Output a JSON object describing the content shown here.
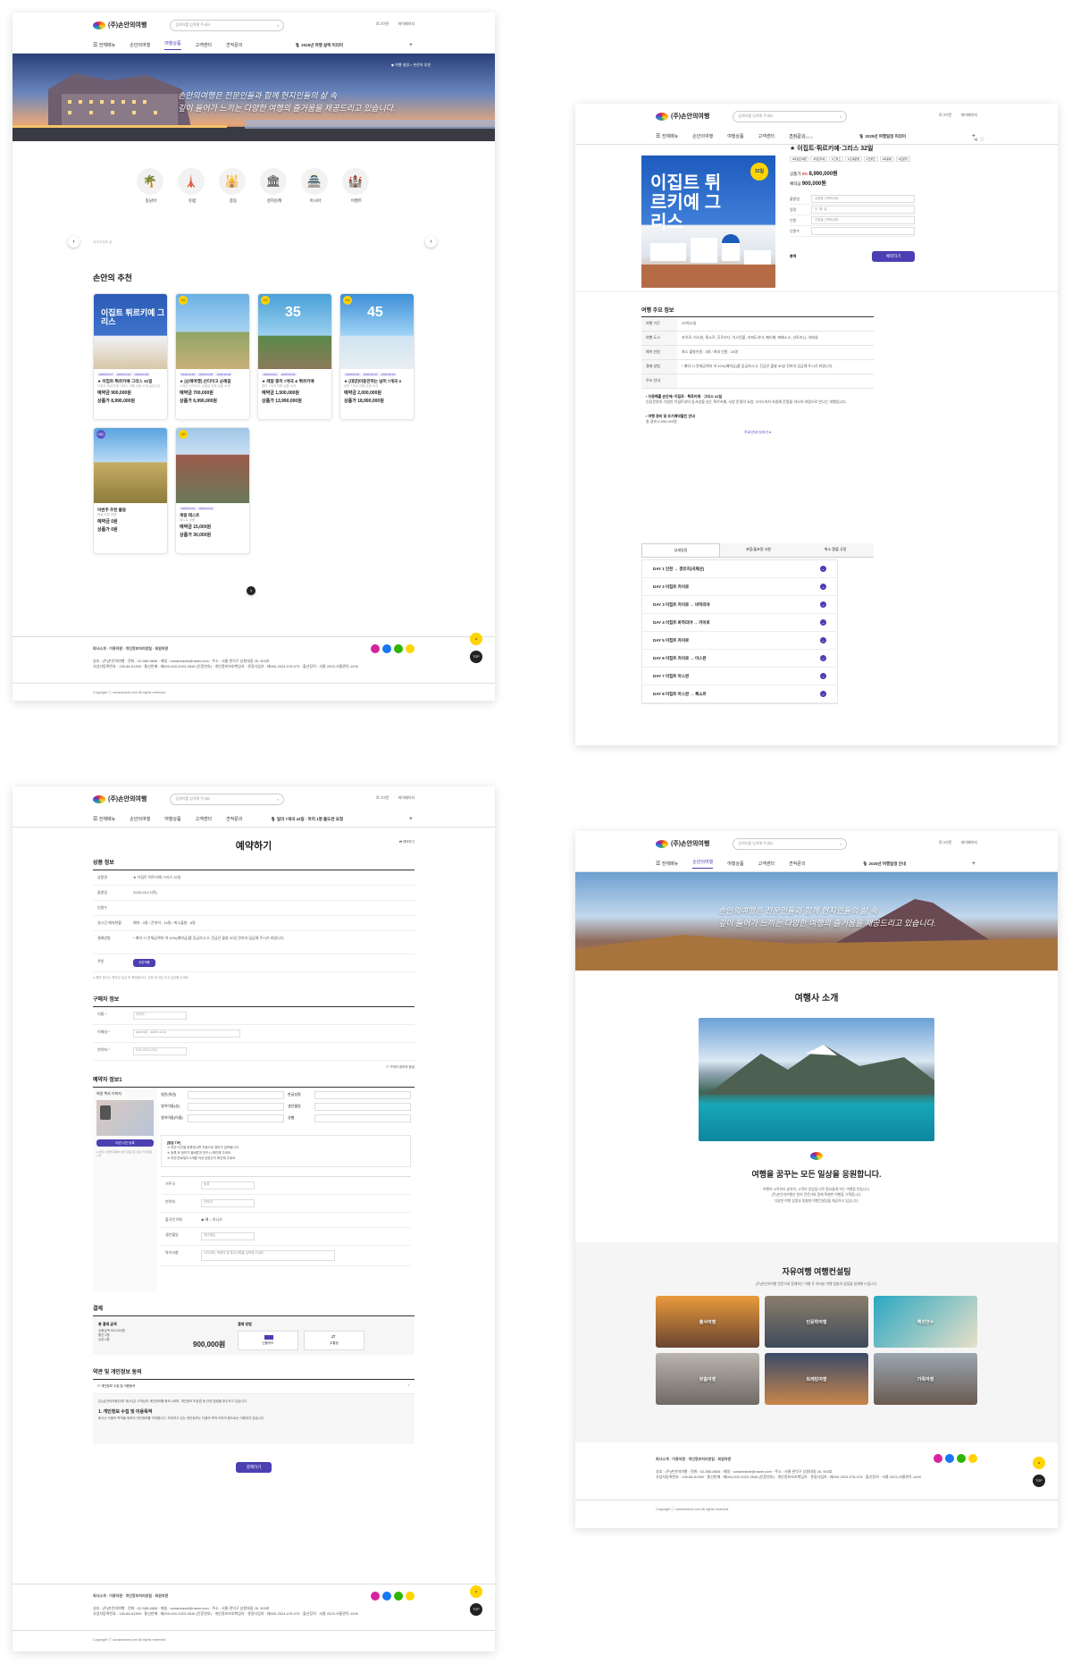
{
  "common": {
    "logo": "(주)손안의여행",
    "search_placeholder": "검색어를 입력해 주세요",
    "util_login": "로그아웃",
    "util_mypage": "마이페이지",
    "nav": [
      "전체메뉴",
      "손안의여행",
      "여행상품",
      "고객센터",
      "견적문의"
    ],
    "ticker_p1": "2025년 여행 살짝 미리미",
    "ticker_p2": "2025년 여행일정 미리미",
    "ticker_p3": "일의 7개국 43일 · 마치 1명 출도연 요청",
    "ticker_p4": "2025년 여행일정 안내",
    "footer_links": "회사소개 · 이용약관 · 개인정보처리방침 · 회원약관",
    "footer_info1": "상호 : (주)손안의여행 · 전화 : 02-585-8608 · 메일 : sonantravel@naver.com · 주소 : 서울 관악구 상원대길 26, 903호",
    "footer_info2": "사업자등록번호 : 135-86-51359 · 통신판매 : 제000-000-2023-3545 (인증번호) · 개인정보보호책임자 · 관광사업자 : 제000-2024-078-075 · 출산장려 · 서울 2023-서울관악-1490",
    "copyright": "Copyright ⓒ sonantravel.com All rights reserved."
  },
  "p1": {
    "hero_text": [
      "손안의여행은 전문인들과 함께 현지인들의 삶 속",
      "깊이 들어가 느끼는 다양한 여행의 즐거움을 제공드리고 있습니다."
    ],
    "hero_tag": "◆ 여행 설명 > 손안의 추천",
    "categories": [
      {
        "icon": "🌴",
        "label": "동남아"
      },
      {
        "icon": "🗼",
        "label": "유럽"
      },
      {
        "icon": "🕌",
        "label": "중동"
      },
      {
        "icon": "🏛",
        "label": "성지순례"
      },
      {
        "icon": "🏯",
        "label": "아시아"
      },
      {
        "icon": "🏰",
        "label": "이벤트"
      }
    ],
    "slider_caption": "여기에 정보 글",
    "section_title": "손안의 추천",
    "cards": [
      {
        "tags": [
          "2025.03.27",
          "2025.04.01",
          "2025.04.18"
        ],
        "name": "★ 이집트·튀르키예·그리스 32일",
        "desc": "이집트·튀르키예·그리스 여행 상품 소개 글입니다",
        "price1": "예약금 900,000원",
        "price2": "상품가 8,990,000원"
      },
      {
        "tags": [
          "2025.03.20",
          "2025.04.05",
          "2025.05.08"
        ],
        "name": "★ [순례여행] 산티아고 순례길",
        "desc": "스페인 산티아고 순례길 여행 상품 소개",
        "price1": "예약금 700,000원",
        "price2": "상품가 6,990,000원"
      },
      {
        "tags": [
          "2025.04.01",
          "2025.05.03"
        ],
        "name": "★ 레알 중미 7개국 & 튀르키예",
        "desc": "중미 7개국 여행 상품 소개",
        "price1": "예약금 1,500,000원",
        "price2": "상품가 13,990,000원"
      },
      {
        "tags": [
          "2025.04.03",
          "2025.05.01",
          "2025.06.01"
        ],
        "name": "★ [대양]이동전하는 남미 7개국 4",
        "desc": "남미 7개국 여행 상품 소개",
        "price1": "예약금 2,000,000원",
        "price2": "상품가 18,990,000원"
      },
      {
        "tags": [],
        "name": "이번주 추천 출동",
        "desc": "몽골 초원 여행",
        "price1": "예약금 0원",
        "price2": "상품가 0원"
      },
      {
        "tags": [
          "2025.03.01",
          "2025.06.01"
        ],
        "name": "게링 테스트",
        "desc": "테스트 상품",
        "price1": "예약금 15,000원",
        "price2": "상품가 30,000원"
      }
    ]
  },
  "p2": {
    "poster_title": "이집트 튀르키예 그리스",
    "poster_days": "32일",
    "code": "상품코드 A00014",
    "title": "★ 이집트·튀르키예·그리스 32일",
    "chips": [
      "#이집트여행",
      "#튀르키예",
      "#그리스",
      "#고대문명",
      "#크루즈",
      "#지중해",
      "#인문학"
    ],
    "price_label": "상품가",
    "discount": "0%",
    "price": "8,990,000원",
    "deposit_label": "예약금",
    "deposit": "900,000원",
    "fields": [
      {
        "k": "출발일",
        "v": "상품을 선택하세요"
      },
      {
        "k": "일정",
        "v": "년. 월. 일"
      },
      {
        "k": "인원",
        "v": "인원을 선택하세요"
      },
      {
        "k": "인원수",
        "v": ""
      }
    ],
    "total_label": "총액",
    "book_btn": "예약하기",
    "info_title": "여행 주요 정보",
    "table": [
      {
        "k": "여행 기간",
        "v": "29박32일"
      },
      {
        "k": "여행 도시",
        "v": "카이로, 아스완, 룩소르, 후르가다, 이스탄불, 카파도키아, 페티예, 에페소스, 산토리니, 아테네"
      },
      {
        "k": "예약 인원",
        "v": "최소 출발인원 : 8명 / 최대 인원 : 16명"
      },
      {
        "k": "결제 방법",
        "v": "* 예약 시 전체금액의 약 10%(예약금)를 입금하시고, 잔금은 출발 30일 전까지 입금해 주시기 바랍니다."
      },
      {
        "k": "주요 안내",
        "v": ""
      }
    ],
    "notes_title": "▪ 지중해를 손안에! 이집트 · 튀르키예 · 그리스 32일",
    "notes": "인류문명의 기원인 이집트부터 동서양을 잇는 튀르키예, 서양 문명의 요람 그리스까지 지중해 문명을 하나의 여정으로 만나는 여행입니다.",
    "notes_title2": "▪ 여행 경비 및 조기예약할인 안내",
    "notes2": "총 경비 8,990,000원",
    "more": "주요안내 더보기 ▾",
    "tabs": [
      "상세일정",
      "포함/불포함 사항",
      "취소·환불 규정"
    ],
    "days": [
      "DAY 1  인천 → 경유지(국제선)",
      "DAY 2  이집트 카이로",
      "DAY 3  이집트 카이로 → 바하리야",
      "DAY 4  이집트 바하리야 → 카이로",
      "DAY 5  이집트 카이로",
      "DAY 6  이집트 카이로 → 아스완",
      "DAY 7  이집트 아스완",
      "DAY 8  이집트 아스완 → 룩소르"
    ]
  },
  "p3": {
    "page_title": "예약하기",
    "print": "🖶 예약하기",
    "sec1": "상품 정보",
    "prod": [
      {
        "k": "상품명",
        "v": "★ 이집트·튀르키예·그리스 32일"
      },
      {
        "k": "출발일",
        "v": "2025-03-27(목)"
      },
      {
        "k": "인원수",
        "v": ""
      },
      {
        "k": "실시간 예약현황",
        "v": "예약 : 0명 / 잔여석 : 16명 / 최소출발 : 8명"
      },
      {
        "k": "결제방법",
        "v": "* 예약 시 전체금액의 약 10%(예약금)를 입금하시고, 잔금은 출발 30일 전까지 입금해 주시기 바랍니다."
      },
      {
        "k": "쿠폰",
        "v": ""
      }
    ],
    "coupon_btn": "쿠폰적용",
    "note1": "● 예약 접수는 예약금 입금 후 확정됩니다. 신청 후 3일 이내 입금해 주세요.",
    "sec2": "구매자 정보",
    "buyer": [
      {
        "k": "이름 *",
        "v": "관리자"
      },
      {
        "k": "이메일 *",
        "v": "admin@ · admin.co.kr"
      },
      {
        "k": "연락처 *",
        "v": "010-1234-1234"
      }
    ],
    "sec3": "예약자 정보1",
    "same_check": "☐ 구매자 정보와 동일",
    "passport_label": "여권 복사 이미지",
    "passport_btn": "여권 사진 등록",
    "passport_note": "● 여권 사진을 등록하시면 자동으로 정보가 입력됩니다.",
    "ps_fields": [
      "영문(여권)",
      "한글성명",
      "영어이름(성)",
      "생년월일",
      "영어이름(이름)",
      "성별"
    ],
    "notice_title": "[알림 TIP]",
    "notice_lines": [
      "① 여권 사진을 등록하시면 자동으로 정보가 입력됩니다.",
      "② 등록 후 정보가 올바른지 반드시 확인해 주세요.",
      "③ 여권 만료일이 6개월 이상 남았는지 확인해 주세요."
    ],
    "extra": [
      {
        "k": "거주국",
        "v": "등록"
      },
      {
        "k": "연락처",
        "v": "연락처"
      },
      {
        "k": "출국인 여부",
        "v": "◉ 예  ○ 아니오"
      },
      {
        "k": "생년월일",
        "v": "생년월일"
      },
      {
        "k": "특이사항",
        "v": "식이제한, 복용약 등 특이사항을 입력해 주세요."
      }
    ],
    "sec4": "결제",
    "pay_total_label": "총 결제 금액",
    "pay_items": [
      "상품금액 900,000원",
      "할인 0원",
      "쿠폰 0원"
    ],
    "pay_total": "900,000원",
    "pay_method_label": "결제 방법",
    "pay_methods": [
      "신용카드",
      "무통장"
    ],
    "sec5": "약관 및 개인정보 동의",
    "agree_all": "☐ 개인정보 수집 및 이용동의",
    "terms_text": "(주)손안의여행(이하 '회사')은 고객님의 개인정보를 중요시하며, 개인정보 보호법 등 관련 법령을 준수하고 있습니다.",
    "terms_h": "1. 개인정보 수집 및 이용목적",
    "terms_p": "회사는 다음의 목적을 위하여 개인정보를 처리합니다. 처리하고 있는 개인정보는 다음의 목적 이외의 용도로는 이용되지 않습니다.",
    "submit": "결제하기"
  },
  "p4": {
    "hero_text": [
      "손안의여행은 전문인들과 함께 현지인들의 삶 속",
      "깊이 들어가 느끼는 다양한 여행의 즐거움을 제공드리고 있습니다."
    ],
    "intro_title": "여행사 소개",
    "slogan": "여행을 꿈꾸는 모든 일상을 응원합니다.",
    "slogan_text": [
      "여행의 시작부터 끝까지, 고객의 일상을 더욱 풍요롭게 하는 여행을 만듭니다.",
      "(주)손안의여행은 현지 전문가와 함께 특별한 여행을 기획합니다.",
      "다양한 여행 상품과 맞춤형 여행컨설팅을 제공하고 있습니다."
    ],
    "consult_title": "자유여행 여행컨설팅",
    "consult_text": "(주)손안의여행 전문가와 함께하는 여행 후 여러분 여행 맞춤의 일정을 설계해 드립니다.",
    "consult": [
      {
        "label": "출사여행"
      },
      {
        "label": "인문학여행"
      },
      {
        "label": "해외연수"
      },
      {
        "label": "맞춤여행"
      },
      {
        "label": "트레킹여행"
      },
      {
        "label": "가족여행"
      }
    ]
  }
}
